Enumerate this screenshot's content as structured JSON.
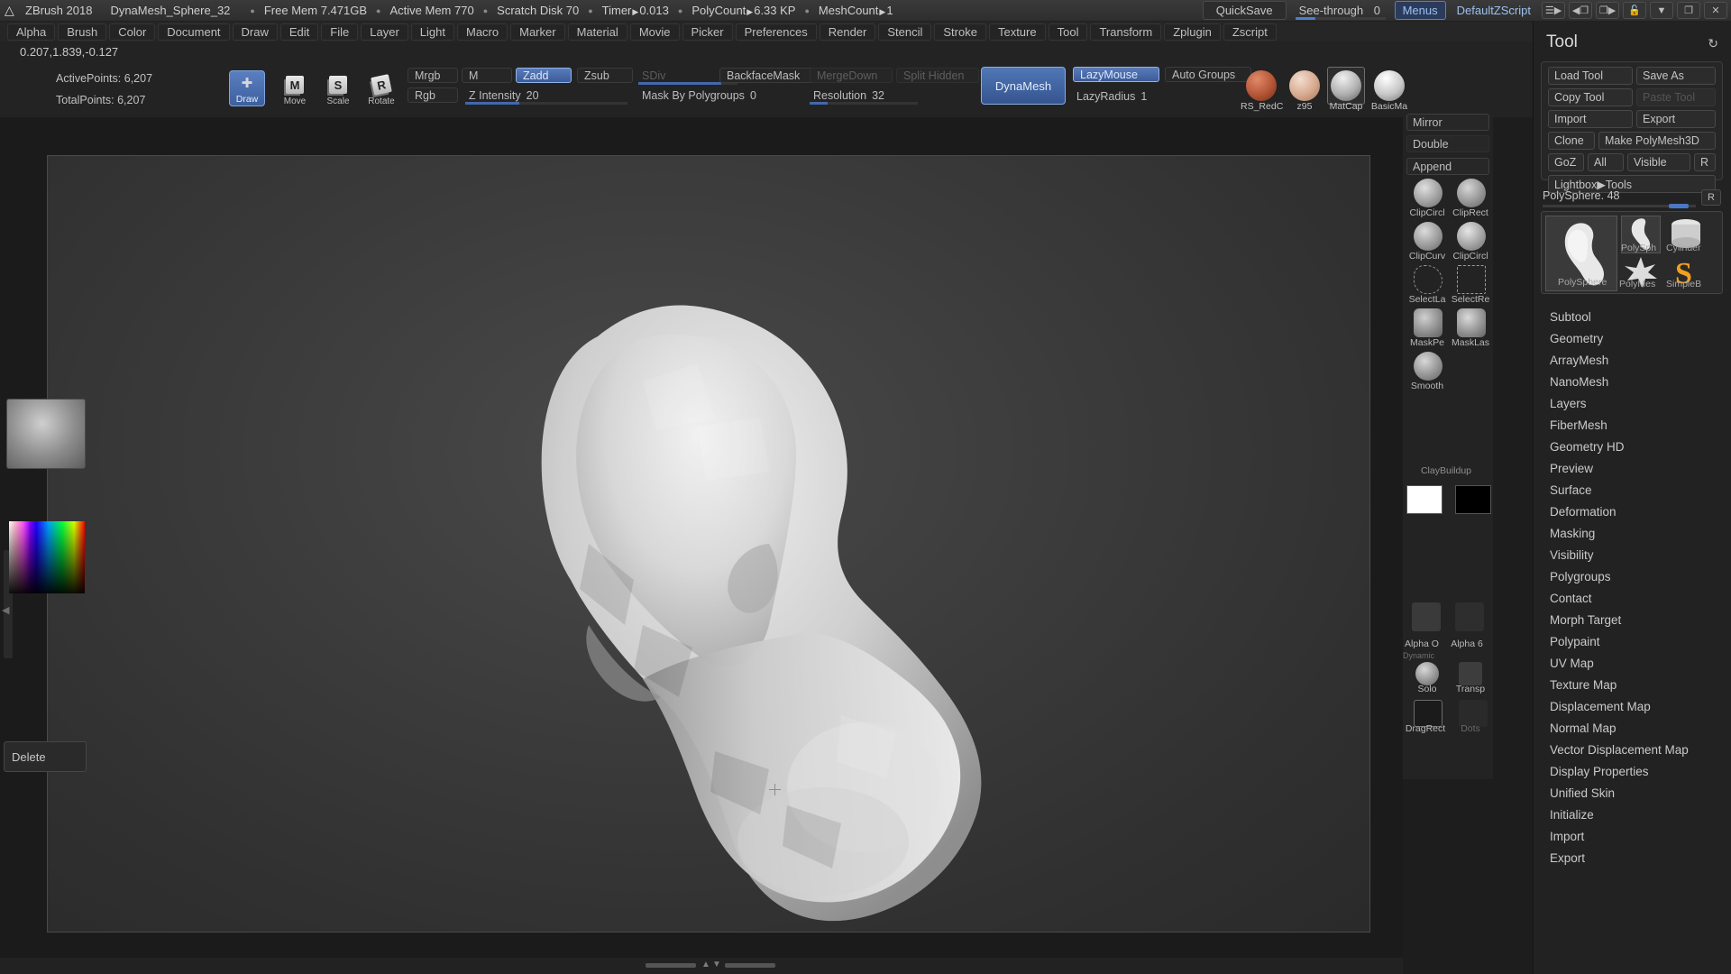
{
  "titlebar": {
    "logo_icon": "zbrush-logo-icon",
    "app_name": "ZBrush 2018",
    "document_name": "DynaMesh_Sphere_32",
    "stats": [
      {
        "label": "Free Mem",
        "value": "7.471GB",
        "arrow": false
      },
      {
        "label": "Active Mem",
        "value": "770",
        "arrow": false
      },
      {
        "label": "Scratch Disk",
        "value": "70",
        "arrow": false
      },
      {
        "label": "Timer",
        "value": "0.013",
        "arrow": true
      },
      {
        "label": "PolyCount",
        "value": "6.33 KP",
        "arrow": true
      },
      {
        "label": "MeshCount",
        "value": "1",
        "arrow": true
      }
    ],
    "quicksave": "QuickSave",
    "seethrough_label": "See-through",
    "seethrough_value": "0",
    "menus": "Menus",
    "default_zscript": "DefaultZScript",
    "window_icons": [
      "sliders-icon",
      "move-left-icon",
      "move-right-icon",
      "lock-icon",
      "minimize-icon",
      "restore-icon",
      "close-icon"
    ]
  },
  "menubar": {
    "items": [
      "Alpha",
      "Brush",
      "Color",
      "Document",
      "Draw",
      "Edit",
      "File",
      "Layer",
      "Light",
      "Macro",
      "Marker",
      "Material",
      "Movie",
      "Picker",
      "Preferences",
      "Render",
      "Stencil",
      "Stroke",
      "Texture",
      "Tool",
      "Transform",
      "Zplugin",
      "Zscript"
    ]
  },
  "shelf": {
    "coords": "0.207,1.839,-0.127",
    "active_points_label": "ActivePoints:",
    "active_points_value": "6,207",
    "total_points_label": "TotalPoints:",
    "total_points_value": "6,207",
    "draw_button": "Draw",
    "move_button": "Move",
    "move_key": "M",
    "scale_button": "Scale",
    "scale_key": "S",
    "rotate_button": "Rotate",
    "rotate_key": "R",
    "mrgb": "Mrgb",
    "rgb": "Rgb",
    "m": "M",
    "zadd": "Zadd",
    "zsub": "Zsub",
    "z_intensity_label": "Z Intensity",
    "z_intensity_value": "20",
    "sdiv_label": "SDiv",
    "mask_by_polygroups_label": "Mask By Polygroups",
    "mask_by_polygroups_value": "0",
    "backfacemask": "BackfaceMask",
    "resolution_label": "Resolution",
    "resolution_value": "32",
    "mergedown": "MergeDown",
    "split_hidden": "Split Hidden",
    "dynamesh": "DynaMesh",
    "lazymouse": "LazyMouse",
    "lazyradius_label": "LazyRadius",
    "lazyradius_value": "1",
    "auto_groups": "Auto Groups",
    "materials": [
      {
        "name": "RS_RedC",
        "color": "#b45436"
      },
      {
        "name": "z95",
        "color": "#d6a98e"
      },
      {
        "name": "MatCap",
        "color": "#b8b8b8",
        "selected": true
      },
      {
        "name": "BasicMa",
        "color": "#d5d5d5"
      }
    ]
  },
  "brush_shelf": {
    "mirror": "Mirror",
    "double": "Double",
    "append": "Append",
    "brushes": [
      {
        "name": "ClipCircl",
        "icon": "clip-circle-center-icon"
      },
      {
        "name": "ClipRect",
        "icon": "clip-rect-icon"
      },
      {
        "name": "ClipCurv",
        "icon": "clip-curve-icon"
      },
      {
        "name": "ClipCircl",
        "icon": "clip-circle-icon"
      },
      {
        "name": "SelectLa",
        "icon": "select-lasso-icon"
      },
      {
        "name": "SelectRe",
        "icon": "select-rect-icon"
      },
      {
        "name": "MaskPe",
        "icon": "mask-pen-icon"
      },
      {
        "name": "MaskLas",
        "icon": "mask-lasso-icon"
      },
      {
        "name": "Smooth",
        "icon": "smooth-brush-icon"
      }
    ],
    "current_brush": "ClayBuildup",
    "alpha_off": "Alpha O",
    "alpha_60": "Alpha 6",
    "dynamic_label": "Dynamic",
    "solo": "Solo",
    "transp": "Transp",
    "dragrect": "DragRect",
    "dots": "Dots",
    "delete": "Delete"
  },
  "tool_panel": {
    "title": "Tool",
    "refresh_icon": "refresh-icon",
    "buttons": {
      "load_tool": "Load Tool",
      "save_as": "Save As",
      "copy_tool": "Copy Tool",
      "paste_tool": "Paste Tool",
      "import": "Import",
      "export": "Export",
      "clone": "Clone",
      "make_polymesh3d": "Make PolyMesh3D",
      "goz": "GoZ",
      "all": "All",
      "visible": "Visible",
      "r": "R",
      "lightbox_tools": "Lightbox▶Tools"
    },
    "current_tool_label": "PolySphere. 48",
    "current_tool_r": "R",
    "thumbnails": [
      {
        "name": "PolySphere",
        "icon": "polysphere-head-thumb"
      },
      {
        "name": "PolySph",
        "icon": "polysphere-thumb"
      },
      {
        "name": "Cylinder",
        "icon": "cylinder-thumb"
      },
      {
        "name": "PolyMes",
        "icon": "polymesh-star-thumb"
      },
      {
        "name": "SimpleB",
        "icon": "simplebrush-s-thumb"
      }
    ],
    "menu_items": [
      "Subtool",
      "Geometry",
      "ArrayMesh",
      "NanoMesh",
      "Layers",
      "FiberMesh",
      "Geometry HD",
      "Preview",
      "Surface",
      "Deformation",
      "Masking",
      "Visibility",
      "Polygroups",
      "Contact",
      "Morph Target",
      "Polypaint",
      "UV Map",
      "Texture Map",
      "Displacement Map",
      "Normal Map",
      "Vector Displacement Map",
      "Display Properties",
      "Unified Skin",
      "Initialize",
      "Import",
      "Export"
    ]
  },
  "colors": {
    "accent": "#4a78c8",
    "panel_bg": "#232323",
    "canvas_bg": "#3b3b3b"
  }
}
